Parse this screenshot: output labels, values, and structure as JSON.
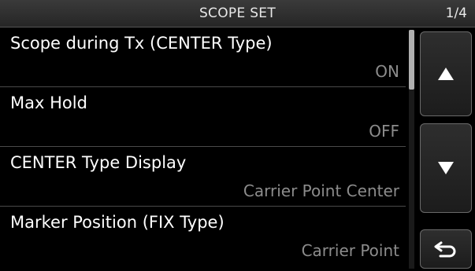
{
  "header": {
    "title": "SCOPE SET",
    "page": "1/4"
  },
  "menu": {
    "items": [
      {
        "label": "Scope during Tx (CENTER Type)",
        "value": "ON"
      },
      {
        "label": "Max Hold",
        "value": "OFF"
      },
      {
        "label": "CENTER Type Display",
        "value": "Carrier Point Center"
      },
      {
        "label": "Marker Position (FIX Type)",
        "value": "Carrier Point"
      }
    ]
  },
  "scrollbar": {
    "position_fraction": 0,
    "visible_fraction": 0.25
  },
  "buttons": {
    "up_icon": "triangle-up-icon",
    "down_icon": "triangle-down-icon",
    "back_icon": "return-arrow-icon"
  },
  "colors": {
    "background": "#000000",
    "label": "#ffffff",
    "value": "#8c8c8c",
    "divider": "#4a4a4a"
  }
}
